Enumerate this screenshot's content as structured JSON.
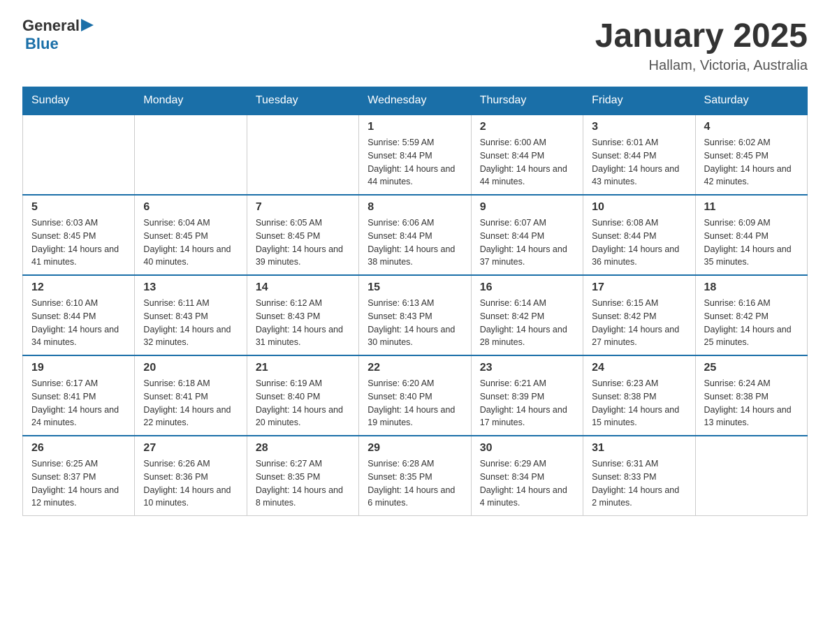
{
  "logo": {
    "general": "General",
    "blue": "Blue"
  },
  "title": {
    "month": "January 2025",
    "location": "Hallam, Victoria, Australia"
  },
  "headers": [
    "Sunday",
    "Monday",
    "Tuesday",
    "Wednesday",
    "Thursday",
    "Friday",
    "Saturday"
  ],
  "weeks": [
    [
      {
        "day": "",
        "info": ""
      },
      {
        "day": "",
        "info": ""
      },
      {
        "day": "",
        "info": ""
      },
      {
        "day": "1",
        "info": "Sunrise: 5:59 AM\nSunset: 8:44 PM\nDaylight: 14 hours and 44 minutes."
      },
      {
        "day": "2",
        "info": "Sunrise: 6:00 AM\nSunset: 8:44 PM\nDaylight: 14 hours and 44 minutes."
      },
      {
        "day": "3",
        "info": "Sunrise: 6:01 AM\nSunset: 8:44 PM\nDaylight: 14 hours and 43 minutes."
      },
      {
        "day": "4",
        "info": "Sunrise: 6:02 AM\nSunset: 8:45 PM\nDaylight: 14 hours and 42 minutes."
      }
    ],
    [
      {
        "day": "5",
        "info": "Sunrise: 6:03 AM\nSunset: 8:45 PM\nDaylight: 14 hours and 41 minutes."
      },
      {
        "day": "6",
        "info": "Sunrise: 6:04 AM\nSunset: 8:45 PM\nDaylight: 14 hours and 40 minutes."
      },
      {
        "day": "7",
        "info": "Sunrise: 6:05 AM\nSunset: 8:45 PM\nDaylight: 14 hours and 39 minutes."
      },
      {
        "day": "8",
        "info": "Sunrise: 6:06 AM\nSunset: 8:44 PM\nDaylight: 14 hours and 38 minutes."
      },
      {
        "day": "9",
        "info": "Sunrise: 6:07 AM\nSunset: 8:44 PM\nDaylight: 14 hours and 37 minutes."
      },
      {
        "day": "10",
        "info": "Sunrise: 6:08 AM\nSunset: 8:44 PM\nDaylight: 14 hours and 36 minutes."
      },
      {
        "day": "11",
        "info": "Sunrise: 6:09 AM\nSunset: 8:44 PM\nDaylight: 14 hours and 35 minutes."
      }
    ],
    [
      {
        "day": "12",
        "info": "Sunrise: 6:10 AM\nSunset: 8:44 PM\nDaylight: 14 hours and 34 minutes."
      },
      {
        "day": "13",
        "info": "Sunrise: 6:11 AM\nSunset: 8:43 PM\nDaylight: 14 hours and 32 minutes."
      },
      {
        "day": "14",
        "info": "Sunrise: 6:12 AM\nSunset: 8:43 PM\nDaylight: 14 hours and 31 minutes."
      },
      {
        "day": "15",
        "info": "Sunrise: 6:13 AM\nSunset: 8:43 PM\nDaylight: 14 hours and 30 minutes."
      },
      {
        "day": "16",
        "info": "Sunrise: 6:14 AM\nSunset: 8:42 PM\nDaylight: 14 hours and 28 minutes."
      },
      {
        "day": "17",
        "info": "Sunrise: 6:15 AM\nSunset: 8:42 PM\nDaylight: 14 hours and 27 minutes."
      },
      {
        "day": "18",
        "info": "Sunrise: 6:16 AM\nSunset: 8:42 PM\nDaylight: 14 hours and 25 minutes."
      }
    ],
    [
      {
        "day": "19",
        "info": "Sunrise: 6:17 AM\nSunset: 8:41 PM\nDaylight: 14 hours and 24 minutes."
      },
      {
        "day": "20",
        "info": "Sunrise: 6:18 AM\nSunset: 8:41 PM\nDaylight: 14 hours and 22 minutes."
      },
      {
        "day": "21",
        "info": "Sunrise: 6:19 AM\nSunset: 8:40 PM\nDaylight: 14 hours and 20 minutes."
      },
      {
        "day": "22",
        "info": "Sunrise: 6:20 AM\nSunset: 8:40 PM\nDaylight: 14 hours and 19 minutes."
      },
      {
        "day": "23",
        "info": "Sunrise: 6:21 AM\nSunset: 8:39 PM\nDaylight: 14 hours and 17 minutes."
      },
      {
        "day": "24",
        "info": "Sunrise: 6:23 AM\nSunset: 8:38 PM\nDaylight: 14 hours and 15 minutes."
      },
      {
        "day": "25",
        "info": "Sunrise: 6:24 AM\nSunset: 8:38 PM\nDaylight: 14 hours and 13 minutes."
      }
    ],
    [
      {
        "day": "26",
        "info": "Sunrise: 6:25 AM\nSunset: 8:37 PM\nDaylight: 14 hours and 12 minutes."
      },
      {
        "day": "27",
        "info": "Sunrise: 6:26 AM\nSunset: 8:36 PM\nDaylight: 14 hours and 10 minutes."
      },
      {
        "day": "28",
        "info": "Sunrise: 6:27 AM\nSunset: 8:35 PM\nDaylight: 14 hours and 8 minutes."
      },
      {
        "day": "29",
        "info": "Sunrise: 6:28 AM\nSunset: 8:35 PM\nDaylight: 14 hours and 6 minutes."
      },
      {
        "day": "30",
        "info": "Sunrise: 6:29 AM\nSunset: 8:34 PM\nDaylight: 14 hours and 4 minutes."
      },
      {
        "day": "31",
        "info": "Sunrise: 6:31 AM\nSunset: 8:33 PM\nDaylight: 14 hours and 2 minutes."
      },
      {
        "day": "",
        "info": ""
      }
    ]
  ]
}
